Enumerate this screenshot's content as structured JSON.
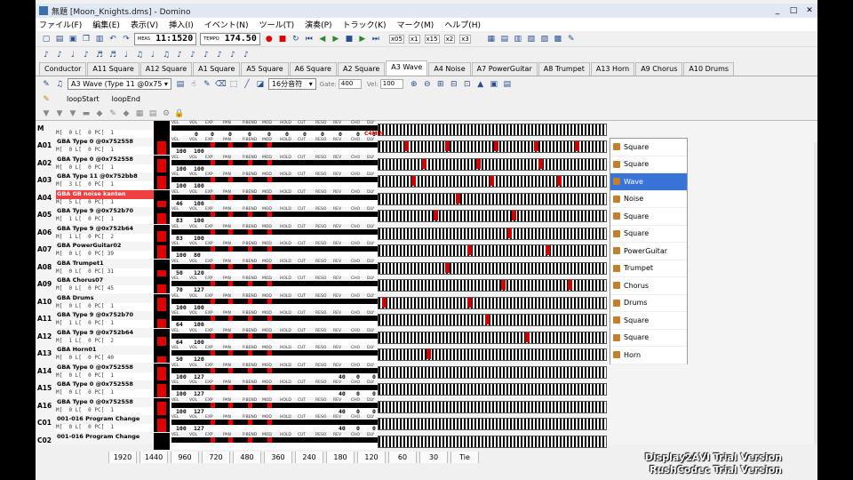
{
  "window": {
    "title": "無題 [Moon_Knights.dms] - Domino",
    "controls": [
      "_",
      "□",
      "✕"
    ]
  },
  "menu": [
    "ファイル(F)",
    "編集(E)",
    "表示(V)",
    "挿入(I)",
    "イベント(N)",
    "ツール(T)",
    "演奏(P)",
    "トラック(K)",
    "マーク(M)",
    "ヘルプ(H)"
  ],
  "toolbar": {
    "meas_label": "MEAS",
    "meas_value": "11:1520",
    "tempo_label": "TEMPO",
    "tempo_value": "174.50",
    "zoom": [
      "x05",
      "x1",
      "x15",
      "x2",
      "x3"
    ]
  },
  "tabs": [
    "Conductor",
    "A11 Square",
    "A12 Square",
    "A1 Square",
    "A5 Square",
    "A6 Square",
    "A2 Square",
    "A3 Wave",
    "A4 Noise",
    "A7 PowerGuitar",
    "A8 Trumpet",
    "A13 Horn",
    "A9 Chorus",
    "A10 Drums"
  ],
  "active_tab": "A3 Wave",
  "track_select": "A3 Wave (Type 11 @0x75",
  "note_length": "16分音符",
  "gate_label": "Gate:",
  "gate_value": "400",
  "vel_label": "Vel:",
  "vel_value": "100",
  "markers": [
    "loopStart",
    "loopEnd"
  ],
  "mixer_labels": [
    "VEL",
    "VOL",
    "EXP",
    "PAN",
    "P.BEND",
    "MOD",
    "HOLD",
    "CUT",
    "RESO",
    "REV",
    "CHO",
    "DLY"
  ],
  "master": {
    "sub": "M[  0 L[  0 PC[  1",
    "values": [
      "",
      "0",
      "0",
      "0",
      "0",
      "0",
      "0",
      "0",
      "0",
      "0",
      "0",
      "0"
    ],
    "tag": "C4MIN"
  },
  "tracks": [
    {
      "id": "A01",
      "name": "GBA Type 0 @0x752558",
      "sub": "M[  0 L[  0 PC[  1",
      "vol": "100",
      "exp": "100",
      "highlight": false,
      "inst": "Square",
      "notes": [
        12,
        30,
        52,
        70,
        88
      ]
    },
    {
      "id": "A02",
      "name": "GBA Type 0 @0x752558",
      "sub": "M[  0 L[  0 PC[  1",
      "vol": "100",
      "exp": "100",
      "highlight": false,
      "inst": "Square",
      "notes": [
        20,
        44,
        72
      ]
    },
    {
      "id": "A03",
      "name": "GBA Type 11 @0x752bb8",
      "sub": "M[  3 L[  0 PC[  1",
      "vol": "100",
      "exp": "100",
      "highlight": false,
      "inst": "Wave",
      "notes": [
        15,
        50,
        80
      ]
    },
    {
      "id": "A04",
      "name": "GBA GB noise kanten",
      "sub": "M[  5 L[  0 PC[  1",
      "vol": "46",
      "exp": "100",
      "highlight": true,
      "inst": "Noise",
      "notes": [
        35
      ]
    },
    {
      "id": "A05",
      "name": "GBA Type 9 @0x752b70",
      "sub": "M[  1 L[  0 PC[  1",
      "vol": "83",
      "exp": "100",
      "highlight": false,
      "inst": "Square",
      "notes": [
        25,
        60
      ]
    },
    {
      "id": "A06",
      "name": "GBA Type 9 @0x752b64",
      "sub": "M[  1 L[  0 PC[  2",
      "vol": "83",
      "exp": "100",
      "highlight": false,
      "inst": "Square",
      "notes": [
        58
      ]
    },
    {
      "id": "A07",
      "name": "GBA PowerGuitar02",
      "sub": "M[  0 L[  0 PC[ 39",
      "vol": "100",
      "exp": "80",
      "highlight": false,
      "inst": "PowerGuitar",
      "notes": [
        40,
        75
      ]
    },
    {
      "id": "A08",
      "name": "GBA Trumpet1",
      "sub": "M[  0 L[  0 PC[ 31",
      "vol": "50",
      "exp": "120",
      "highlight": false,
      "inst": "Trumpet",
      "notes": [
        30
      ]
    },
    {
      "id": "A09",
      "name": "GBA Chorus07",
      "sub": "M[  0 L[  0 PC[ 45",
      "vol": "70",
      "exp": "127",
      "highlight": false,
      "inst": "Chorus",
      "notes": [
        55,
        85
      ]
    },
    {
      "id": "A10",
      "name": "GBA Drums",
      "sub": "M[  0 L[  0 PC[  1",
      "vol": "100",
      "exp": "100",
      "highlight": false,
      "inst": "Drums",
      "notes": [
        2,
        40
      ]
    },
    {
      "id": "A11",
      "name": "GBA Type 9 @0x752b70",
      "sub": "M[  1 L[  0 PC[  1",
      "vol": "64",
      "exp": "100",
      "highlight": false,
      "inst": "Square",
      "notes": [
        48
      ]
    },
    {
      "id": "A12",
      "name": "GBA Type 9 @0x752b64",
      "sub": "M[  1 L[  0 PC[  2",
      "vol": "64",
      "exp": "100",
      "highlight": false,
      "inst": "Square",
      "notes": [
        66
      ]
    },
    {
      "id": "A13",
      "name": "GBA Horn01",
      "sub": "M[  0 L[  0 PC[ 40",
      "vol": "50",
      "exp": "120",
      "highlight": false,
      "inst": "Horn",
      "notes": [
        22
      ]
    },
    {
      "id": "A14",
      "name": "GBA Type 0 @0x752558",
      "sub": "M[  0 L[  0 PC[  1",
      "vol": "100",
      "exp": "127",
      "highlight": false,
      "inst": "",
      "notes": []
    },
    {
      "id": "A15",
      "name": "GBA Type 0 @0x752558",
      "sub": "M[  0 L[  0 PC[  1",
      "vol": "100",
      "exp": "127",
      "highlight": false,
      "inst": "",
      "notes": []
    },
    {
      "id": "A16",
      "name": "GBA Type 0 @0x752558",
      "sub": "M[  0 L[  0 PC[  1",
      "vol": "100",
      "exp": "127",
      "highlight": false,
      "inst": "",
      "notes": []
    },
    {
      "id": "C01",
      "name": "001-016 Program Change",
      "sub": "M[  0 L[  0 PC[  1",
      "vol": "100",
      "exp": "127",
      "highlight": false,
      "inst": "",
      "notes": []
    },
    {
      "id": "C02",
      "name": "001-016 Program Change",
      "sub": "",
      "vol": "",
      "exp": "",
      "highlight": false,
      "inst": "",
      "notes": []
    }
  ],
  "selected_inst_index": 2,
  "tail_values": {
    "rev": "40",
    "cho": "0",
    "dly": "0"
  },
  "quantize": [
    "1920",
    "1440",
    "960",
    "720",
    "480",
    "360",
    "240",
    "180",
    "120",
    "60",
    "30",
    "Tie"
  ],
  "watermark": [
    "Display2AVI Trial Version",
    "RushCodec Trial Version"
  ],
  "colors": {
    "accent_red": "#e00000",
    "selected_blue": "#3874d8"
  }
}
